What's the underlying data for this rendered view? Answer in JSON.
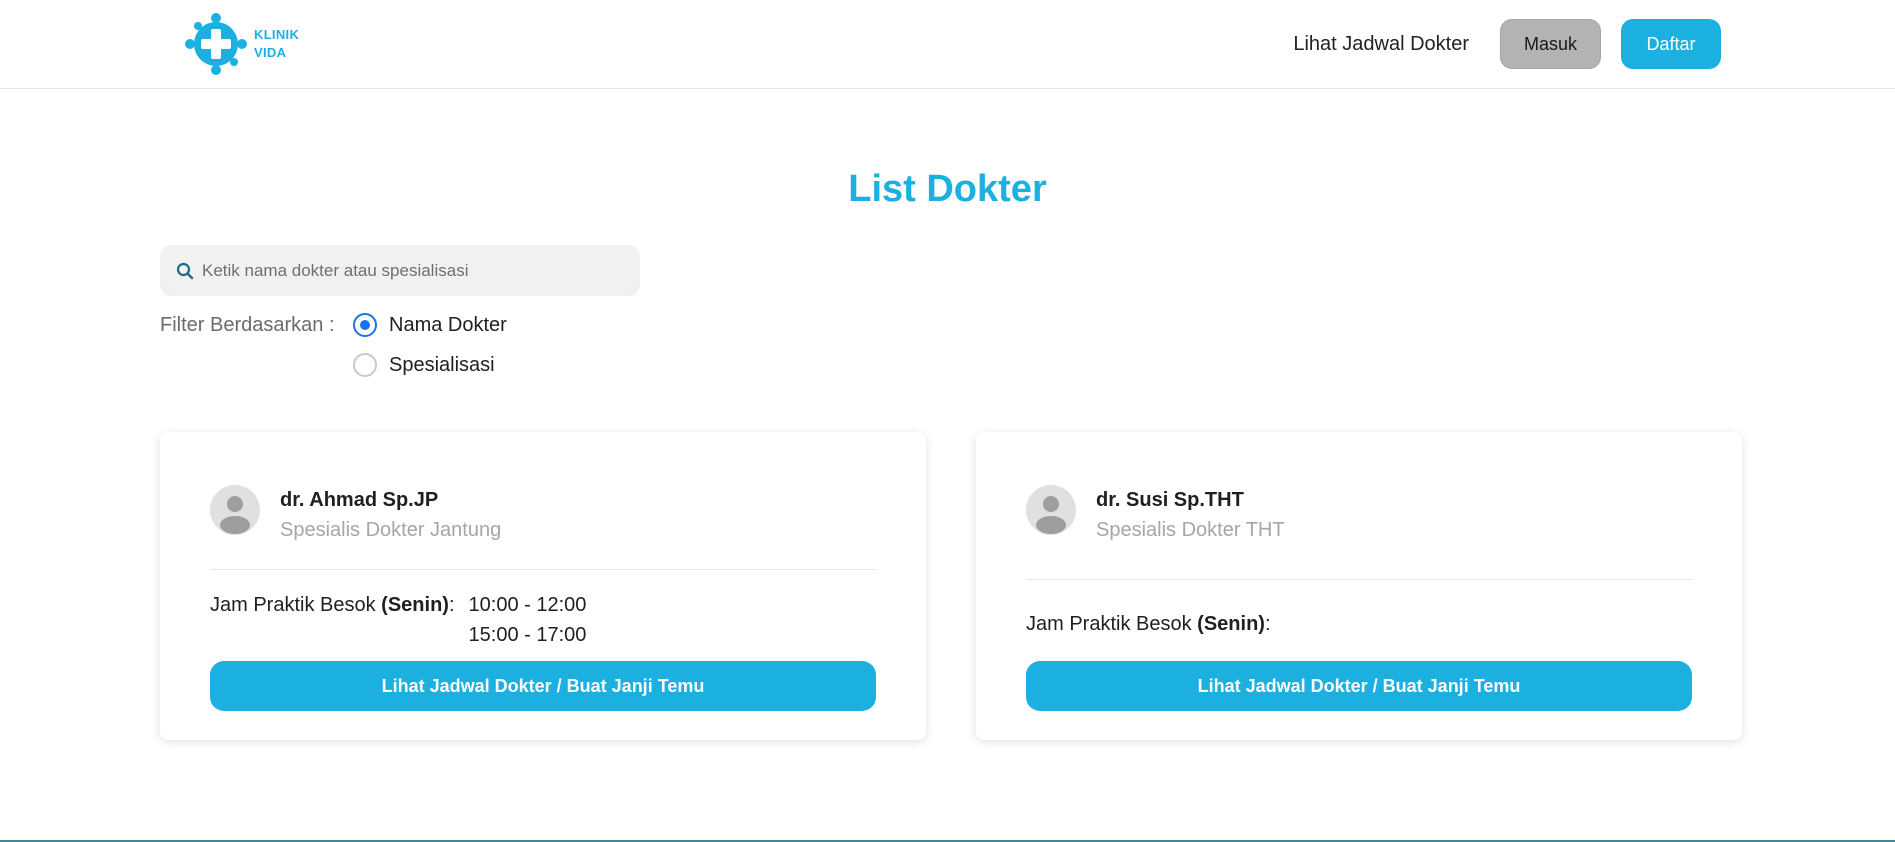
{
  "header": {
    "logo_line1": "KLINIK",
    "logo_line2": "VIDA",
    "nav_link": "Lihat Jadwal Dokter",
    "login_label": "Masuk",
    "register_label": "Daftar"
  },
  "main": {
    "title": "List Dokter",
    "search": {
      "placeholder": "Ketik nama dokter atau spesialisasi",
      "value": ""
    },
    "filter": {
      "label": "Filter Berdasarkan :",
      "options": [
        {
          "label": "Nama Dokter",
          "checked": true
        },
        {
          "label": "Spesialisasi",
          "checked": false
        }
      ]
    },
    "doctors": [
      {
        "name": "dr. Ahmad Sp.JP",
        "specialty": "Spesialis Dokter Jantung",
        "schedule_prefix": "Jam Praktik Besok ",
        "schedule_day": "(Senin)",
        "schedule_suffix": ":",
        "times": [
          "10:00 - 12:00",
          "15:00 - 17:00"
        ],
        "button_label": "Lihat Jadwal Dokter / Buat Janji Temu"
      },
      {
        "name": "dr. Susi Sp.THT",
        "specialty": "Spesialis Dokter THT",
        "schedule_prefix": "Jam Praktik Besok ",
        "schedule_day": "(Senin)",
        "schedule_suffix": ":",
        "times": [],
        "button_label": "Lihat Jadwal Dokter / Buat Janji Temu"
      }
    ]
  },
  "colors": {
    "brand": "#1bb0e0",
    "radio_selected": "#1a73e8",
    "login_button": "#b3b3b3",
    "footer_line": "#3c8a96"
  },
  "icons": {
    "logo": "medical-cross-logo-icon",
    "search": "search-icon",
    "avatar": "user-avatar-icon"
  }
}
